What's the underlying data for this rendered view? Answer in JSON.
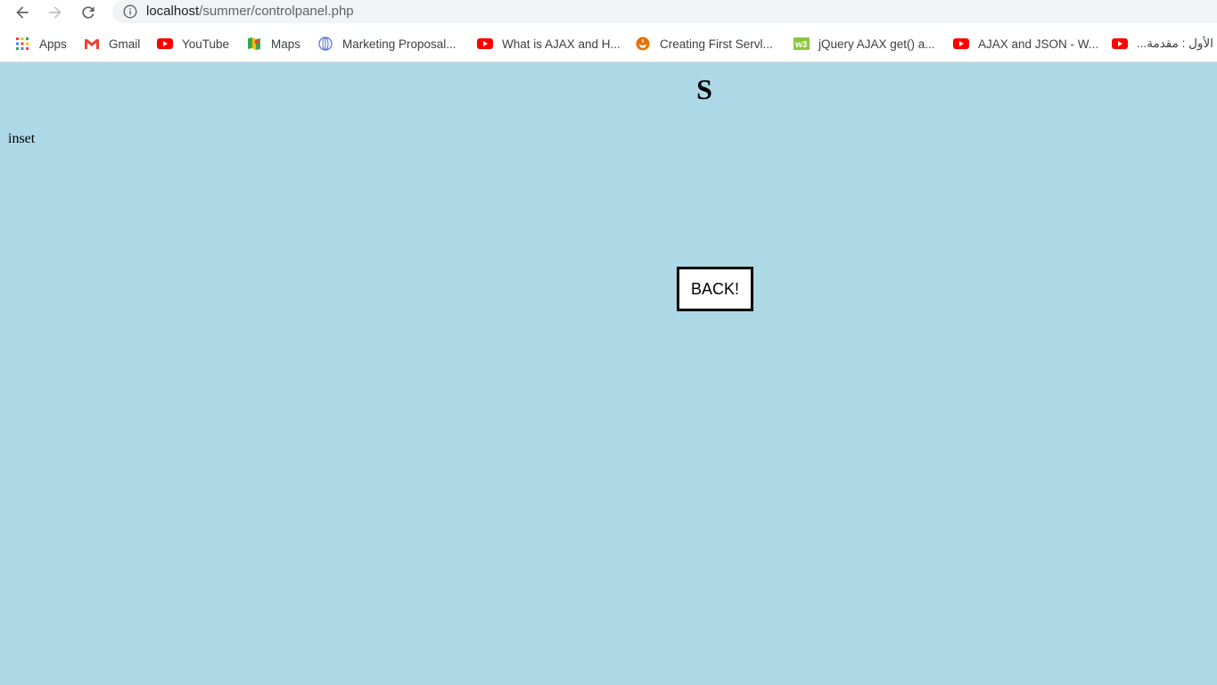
{
  "browser": {
    "url_host": "localhost",
    "url_path": "/summer/controlpanel.php",
    "bookmarks": [
      {
        "label": "Apps",
        "icon": "apps-grid-icon"
      },
      {
        "label": "Gmail",
        "icon": "gmail-icon"
      },
      {
        "label": "YouTube",
        "icon": "youtube-icon"
      },
      {
        "label": "Maps",
        "icon": "maps-icon"
      },
      {
        "label": "Marketing Proposal...",
        "icon": "globe-icon"
      },
      {
        "label": "What is AJAX and H...",
        "icon": "youtube-icon"
      },
      {
        "label": "Creating First Servl...",
        "icon": "java-icon"
      },
      {
        "label": "jQuery AJAX get() a...",
        "icon": "w3schools-icon"
      },
      {
        "label": "AJAX and JSON - W...",
        "icon": "youtube-icon"
      },
      {
        "label": "الأول : مقدمة...",
        "icon": "youtube-icon"
      }
    ]
  },
  "page": {
    "heading": "S",
    "inset_label": "inset",
    "back_button_label": "BACK!",
    "background_color": "#add8e6"
  }
}
